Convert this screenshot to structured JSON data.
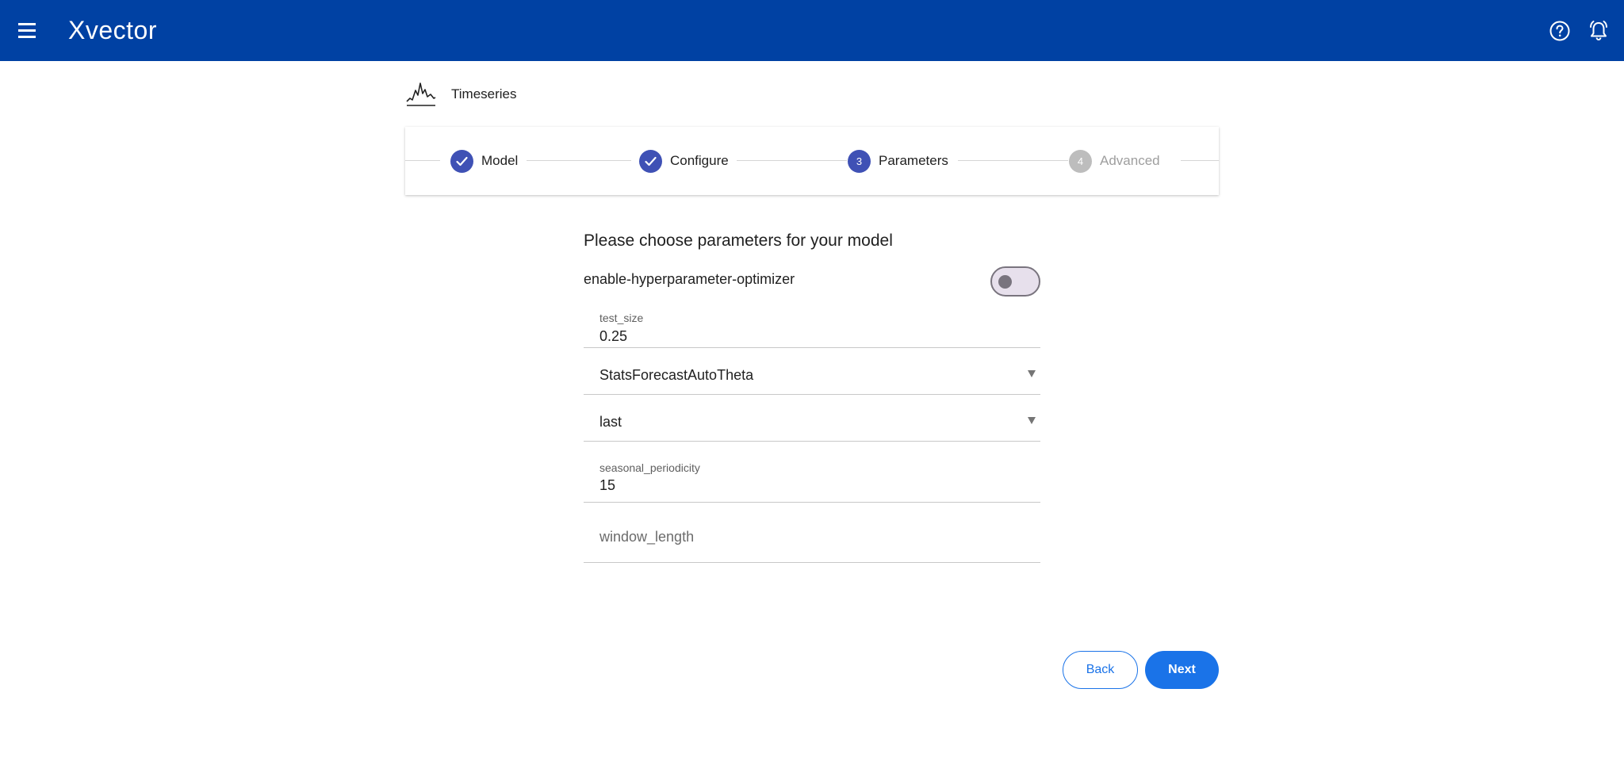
{
  "header": {
    "logo": "Xvector",
    "menu_icon": "hamburger-menu-icon",
    "help_icon": "help-circle-icon",
    "notifications_icon": "bell-icon"
  },
  "page": {
    "section_title": "Timeseries",
    "section_icon": "timeseries-chart-icon"
  },
  "stepper": {
    "steps": [
      {
        "label": "Model",
        "state": "completed",
        "marker": "check-icon"
      },
      {
        "label": "Configure",
        "state": "completed",
        "marker": "check-icon"
      },
      {
        "label": "Parameters",
        "state": "active",
        "marker": "3"
      },
      {
        "label": "Advanced",
        "state": "inactive",
        "marker": "4"
      }
    ]
  },
  "form": {
    "title": "Please choose parameters for your model",
    "toggle": {
      "label": "enable-hyperparameter-optimizer",
      "on": false
    },
    "test_size": {
      "label": "test_size",
      "value": "0.25"
    },
    "model_select": {
      "value": "StatsForecastAutoTheta"
    },
    "method_select": {
      "value": "last"
    },
    "seasonal_periodicity": {
      "label": "seasonal_periodicity",
      "value": "15"
    },
    "window_length": {
      "placeholder": "window_length"
    }
  },
  "actions": {
    "back_label": "Back",
    "next_label": "Next"
  },
  "colors": {
    "header_bg": "#0041a3",
    "step_active": "#3f51b5",
    "step_inactive": "#bdbdbd",
    "primary_button": "#1a73e8"
  }
}
